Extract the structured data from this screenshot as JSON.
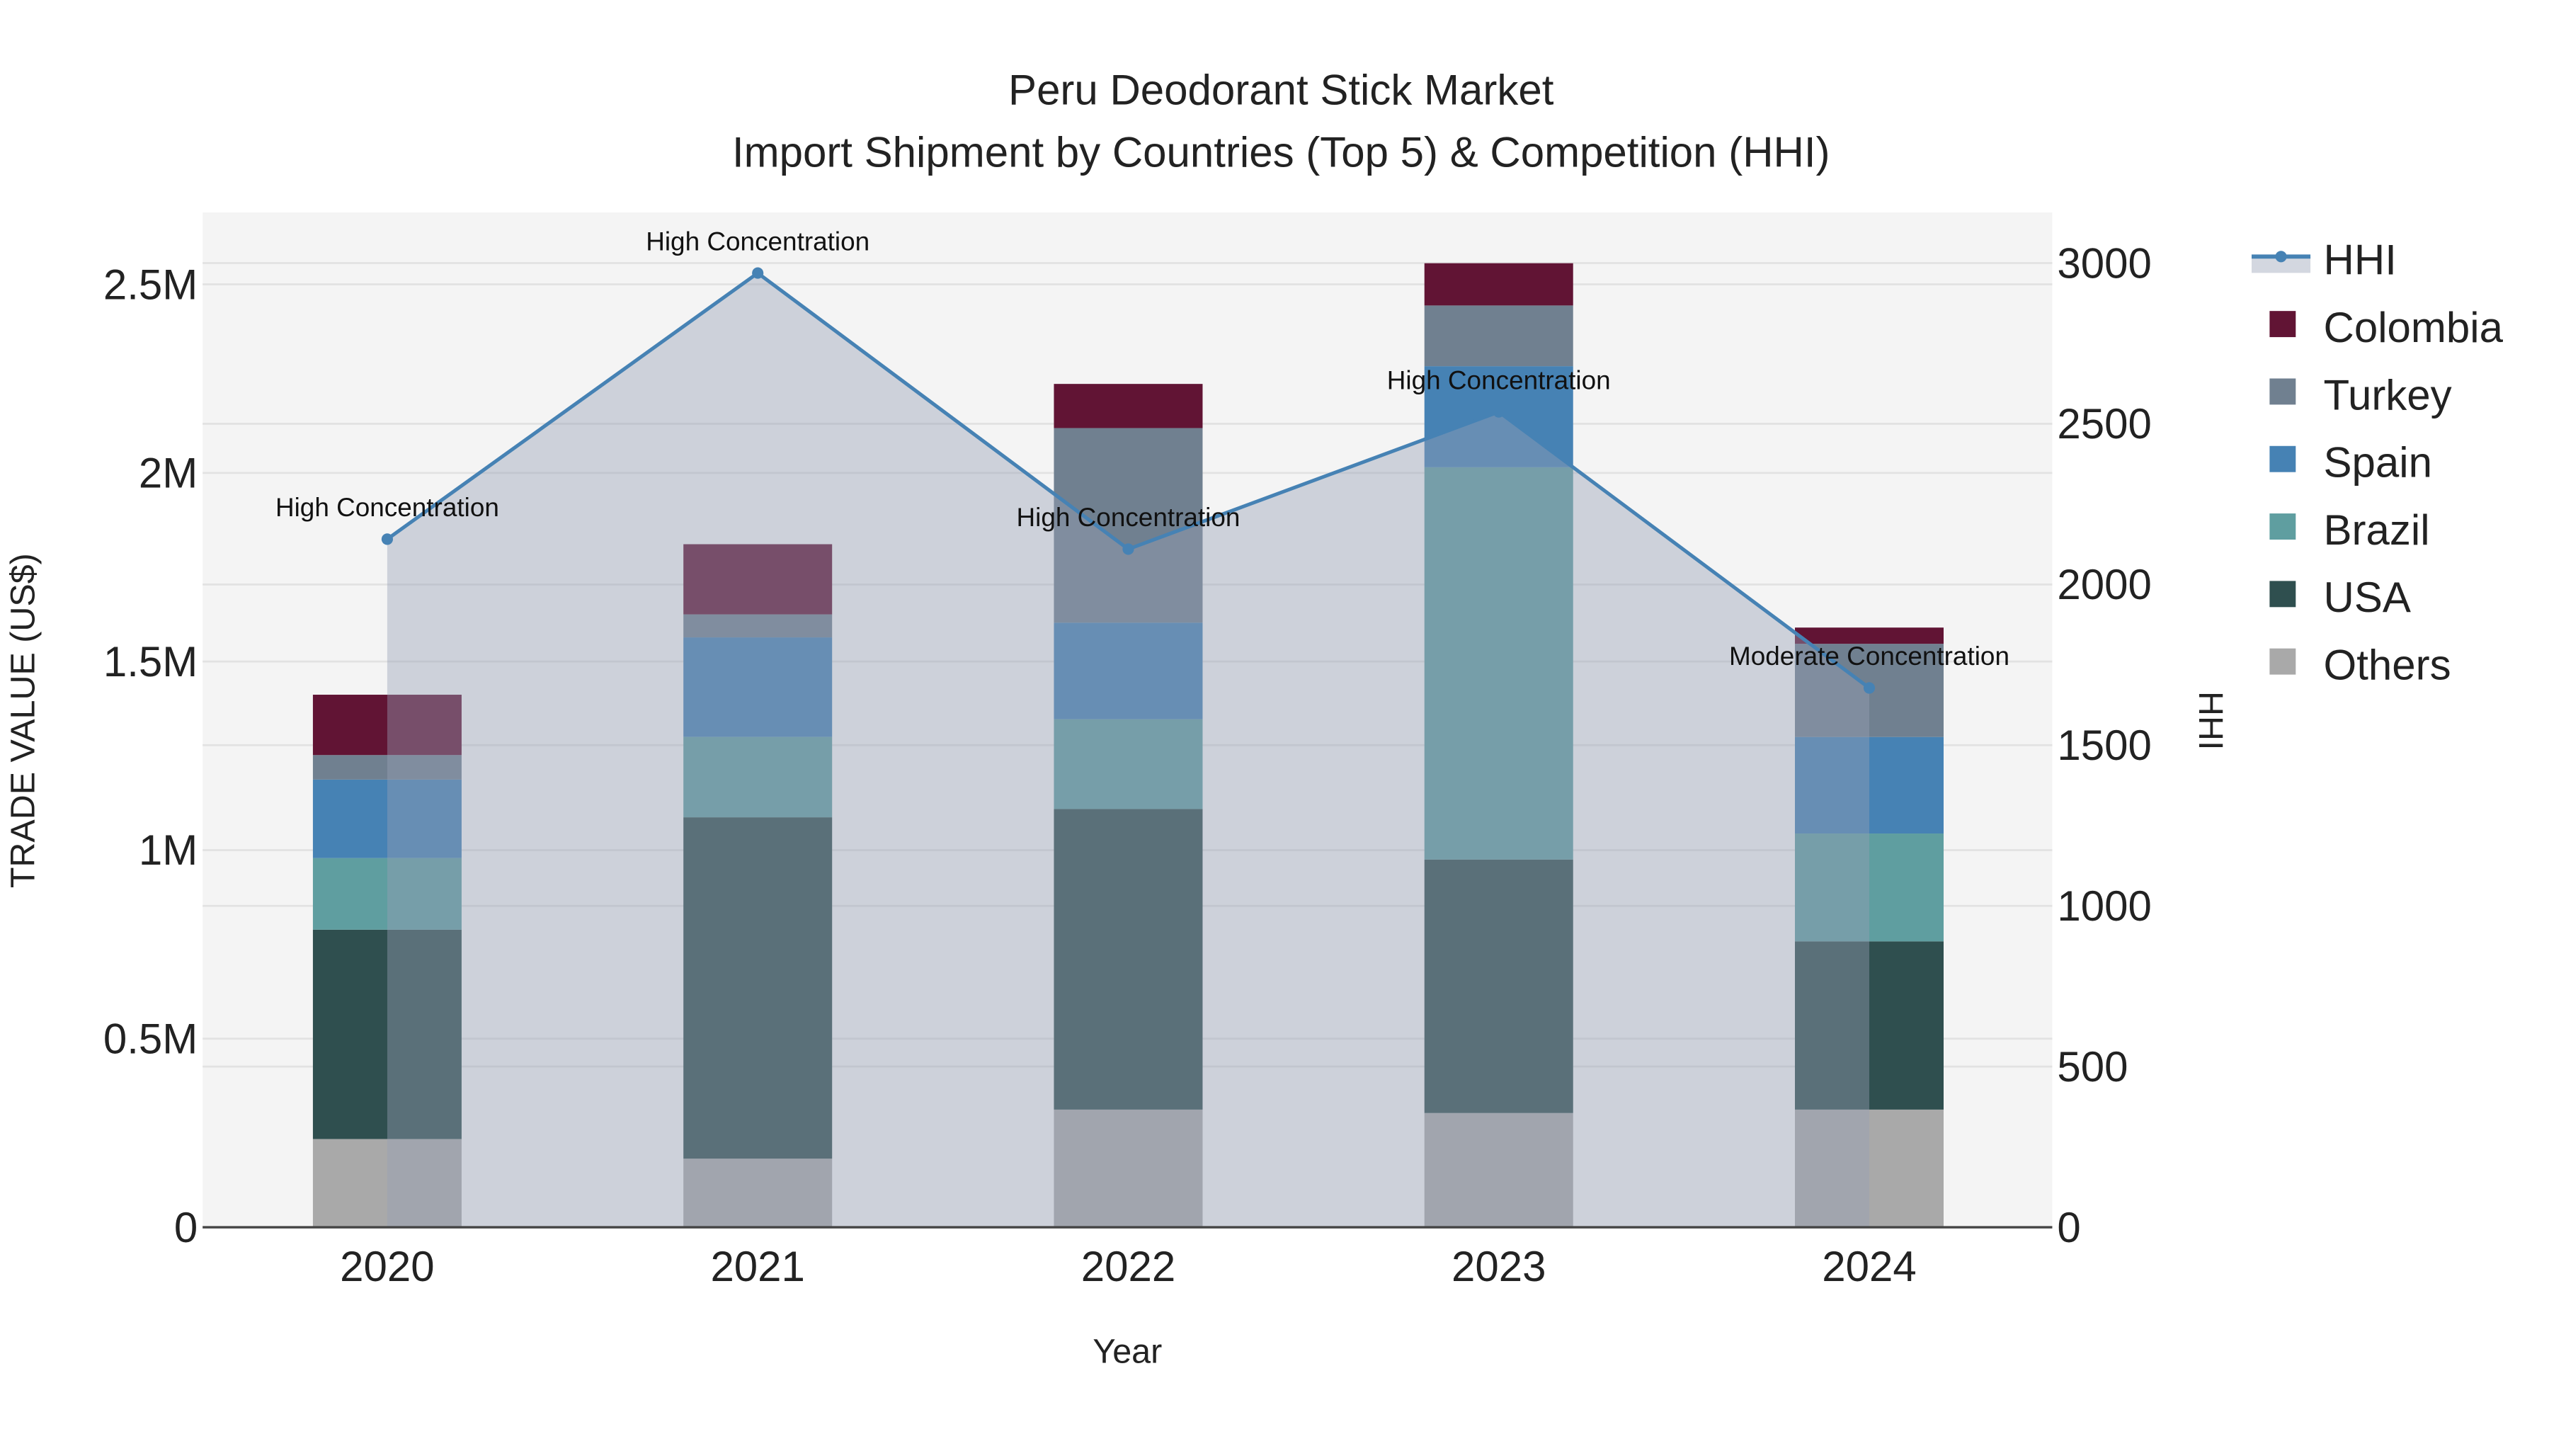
{
  "chart_data": {
    "type": "bar",
    "title": "Peru Deodorant Stick Market",
    "subtitle": "Import Shipment by Countries (Top 5) & Competition (HHI)",
    "xlabel": "Year",
    "ylabel": "TRADE VALUE (US$)",
    "y2label": "HHI",
    "categories": [
      "2020",
      "2021",
      "2022",
      "2023",
      "2024"
    ],
    "ylim": [
      0,
      2690000
    ],
    "y2lim": [
      0,
      3160
    ],
    "yticks": [
      0,
      500000,
      1000000,
      1500000,
      2000000,
      2500000
    ],
    "ytick_labels": [
      "0",
      "0.5M",
      "1M",
      "1.5M",
      "2M",
      "2.5M"
    ],
    "y2ticks": [
      0,
      500,
      1000,
      1500,
      2000,
      2500,
      3000
    ],
    "y2tick_labels": [
      "0",
      "500",
      "1000",
      "1500",
      "2000",
      "2500",
      "3000"
    ],
    "grid": true,
    "legend_position": "right",
    "series": [
      {
        "name": "Others",
        "color": "#a9a9a9",
        "values": [
          234000,
          182000,
          312000,
          303000,
          312000
        ]
      },
      {
        "name": "USA",
        "color": "#2f4f4f",
        "values": [
          555000,
          905000,
          797000,
          672000,
          446000
        ]
      },
      {
        "name": "Brazil",
        "color": "#5f9ea0",
        "values": [
          190000,
          213000,
          238000,
          1040000,
          286000
        ]
      },
      {
        "name": "Spain",
        "color": "#4682b4",
        "values": [
          208000,
          264000,
          256000,
          268000,
          256000
        ]
      },
      {
        "name": "Turkey",
        "color": "#708090",
        "values": [
          65000,
          61000,
          516000,
          161000,
          247000
        ]
      },
      {
        "name": "Colombia",
        "color": "#611434",
        "values": [
          160000,
          186000,
          117000,
          112000,
          43000
        ]
      }
    ],
    "hhi": {
      "name": "HHI",
      "color": "#4682b4",
      "values": [
        2141,
        2969,
        2110,
        2537,
        1678
      ],
      "annotations": [
        "High Concentration",
        "High Concentration",
        "High Concentration",
        "High Concentration",
        "Moderate Concentration"
      ]
    },
    "legend_order": [
      "HHI",
      "Colombia",
      "Turkey",
      "Spain",
      "Brazil",
      "USA",
      "Others"
    ]
  }
}
